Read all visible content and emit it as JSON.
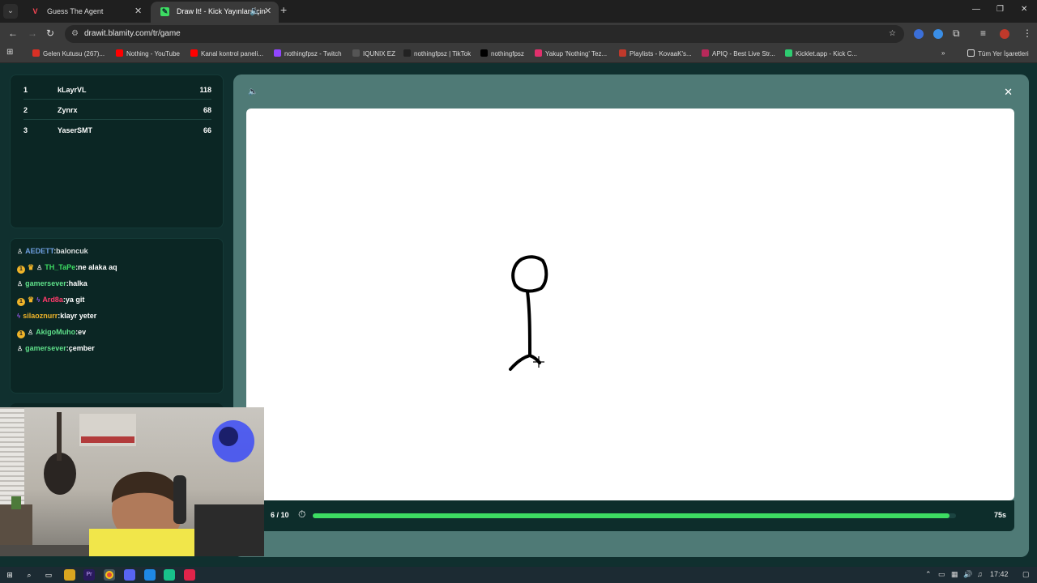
{
  "browser": {
    "tabs": [
      {
        "title": "Guess The Agent",
        "active": false
      },
      {
        "title": "Draw It! - Kick Yayınları İçin",
        "active": true
      }
    ],
    "url": "drawit.blamity.com/tr/game",
    "bookmarks": [
      {
        "label": "Gelen Kutusu (267)...",
        "color": "#d93025"
      },
      {
        "label": "Nothing - YouTube",
        "color": "#ff0000"
      },
      {
        "label": "Kanal kontrol paneli...",
        "color": "#ff0000"
      },
      {
        "label": "nothingfpsz - Twitch",
        "color": "#9146ff"
      },
      {
        "label": "IQUNIX EZ",
        "color": "#555555"
      },
      {
        "label": "nothingfpsz | TikTok",
        "color": "#222222"
      },
      {
        "label": "nothingfpsz",
        "color": "#000000"
      },
      {
        "label": "Yakup 'Nothing' Tez...",
        "color": "#e1306c"
      },
      {
        "label": "Playlists - KovaaK's...",
        "color": "#c0392b"
      },
      {
        "label": "APIQ - Best Live Str...",
        "color": "#b7295a"
      },
      {
        "label": "Kicklet.app - Kick C...",
        "color": "#2ecc71"
      }
    ],
    "all_bookmarks": "Tüm Yer İşaretleri"
  },
  "leaderboard": [
    {
      "rank": "1",
      "name": "kLayrVL",
      "score": "118"
    },
    {
      "rank": "2",
      "name": "Zynrx",
      "score": "68"
    },
    {
      "rank": "3",
      "name": "YaserSMT",
      "score": "66"
    }
  ],
  "chat": [
    {
      "user": "AEDETT",
      "text": ":baloncuk",
      "color": "#7fb3ff",
      "badges": [
        "pawn"
      ]
    },
    {
      "user": "TH_TaPe",
      "text": ":ne alaka aq",
      "color": "#3ddc62",
      "badges": [
        "sub",
        "crown",
        "pawn"
      ]
    },
    {
      "user": "gamersever",
      "text": ":halka",
      "color": "#5fe08a",
      "badges": [
        "pawn"
      ]
    },
    {
      "user": "Ard8a",
      "text": ":ya git",
      "color": "#ff3b6b",
      "badges": [
        "sub",
        "crown",
        "bolt"
      ]
    },
    {
      "user": "silaoznurr",
      "text": ":klayr yeter",
      "color": "#f0b429",
      "badges": [
        "bolt"
      ]
    },
    {
      "user": "AkigoMuho",
      "text": ":ev",
      "color": "#5fe08a",
      "badges": [
        "sub",
        "pawn"
      ]
    },
    {
      "user": "gamersever",
      "text": ":çember",
      "color": "#5fe08a",
      "badges": [
        "pawn"
      ]
    }
  ],
  "game": {
    "round": "6 / 10",
    "seconds": "75s",
    "time_remaining_fraction": 0.99
  },
  "taskbar": {
    "time": "17:42"
  }
}
